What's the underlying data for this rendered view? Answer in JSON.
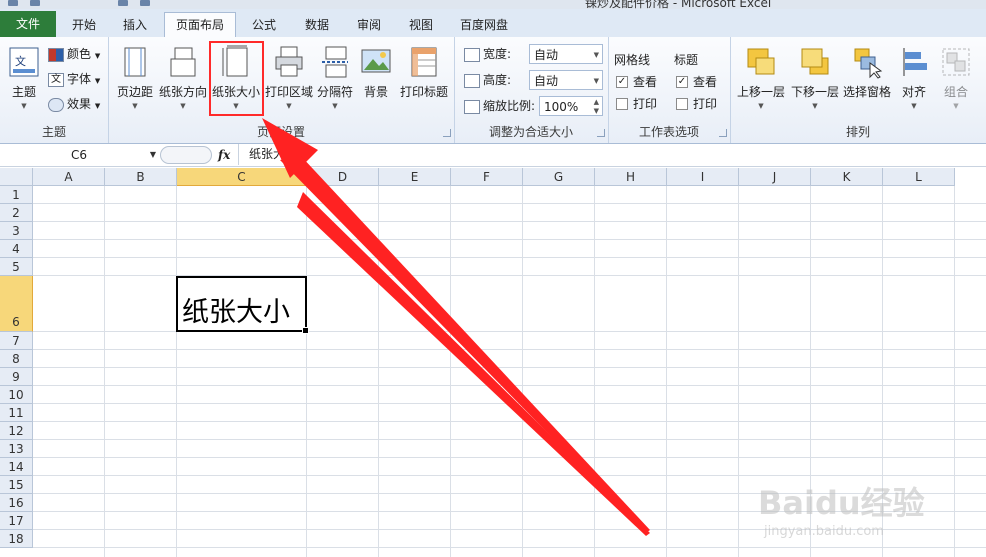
{
  "window": {
    "title": "锞炒及配件价格 - Microsoft Excel"
  },
  "tabs": [
    {
      "label": "文件"
    },
    {
      "label": "开始"
    },
    {
      "label": "插入"
    },
    {
      "label": "页面布局"
    },
    {
      "label": "公式"
    },
    {
      "label": "数据"
    },
    {
      "label": "审阅"
    },
    {
      "label": "视图"
    },
    {
      "label": "百度网盘"
    }
  ],
  "ribbon": {
    "themes": {
      "theme_label": "主题",
      "colors_label": "颜色",
      "fonts_label": "字体",
      "effects_label": "效果",
      "group_label": "主题"
    },
    "page_setup": {
      "margins_label": "页边距",
      "orientation_label": "纸张方向",
      "size_label": "纸张大小",
      "print_area_label": "打印区域",
      "breaks_label": "分隔符",
      "background_label": "背景",
      "print_titles_label": "打印标题",
      "group_label": "页面设置"
    },
    "scale": {
      "width_label": "宽度:",
      "width_value": "自动",
      "height_label": "高度:",
      "height_value": "自动",
      "scale_label": "缩放比例:",
      "scale_value": "100%",
      "group_label": "调整为合适大小"
    },
    "sheet_options": {
      "gridlines_label": "网格线",
      "headings_label": "标题",
      "view_label": "查看",
      "print_label": "打印",
      "group_label": "工作表选项"
    },
    "arrange": {
      "bring_forward_label": "上移一层",
      "send_backward_label": "下移一层",
      "selection_pane_label": "选择窗格",
      "align_label": "对齐",
      "group_label_btn": "组合",
      "group_label": "排列"
    }
  },
  "formula_bar": {
    "name_box": "C6",
    "fx": "fx",
    "content": "纸张大小"
  },
  "sheet": {
    "columns": [
      "A",
      "B",
      "C",
      "D",
      "E",
      "F",
      "G",
      "H",
      "I",
      "J",
      "K",
      "L"
    ],
    "rows": [
      "1",
      "2",
      "3",
      "4",
      "5",
      "6",
      "7",
      "8",
      "9",
      "10",
      "11",
      "12",
      "13",
      "14",
      "15",
      "16",
      "17",
      "18"
    ],
    "active_cell_text": "纸张大小"
  },
  "watermark": {
    "brand": "Baidu经验",
    "url": "jingyan.baidu.com"
  },
  "colors": {
    "file_tab": "#2d7d3a",
    "highlight": "#ff2a2a",
    "selected_header": "#f7d77a"
  }
}
